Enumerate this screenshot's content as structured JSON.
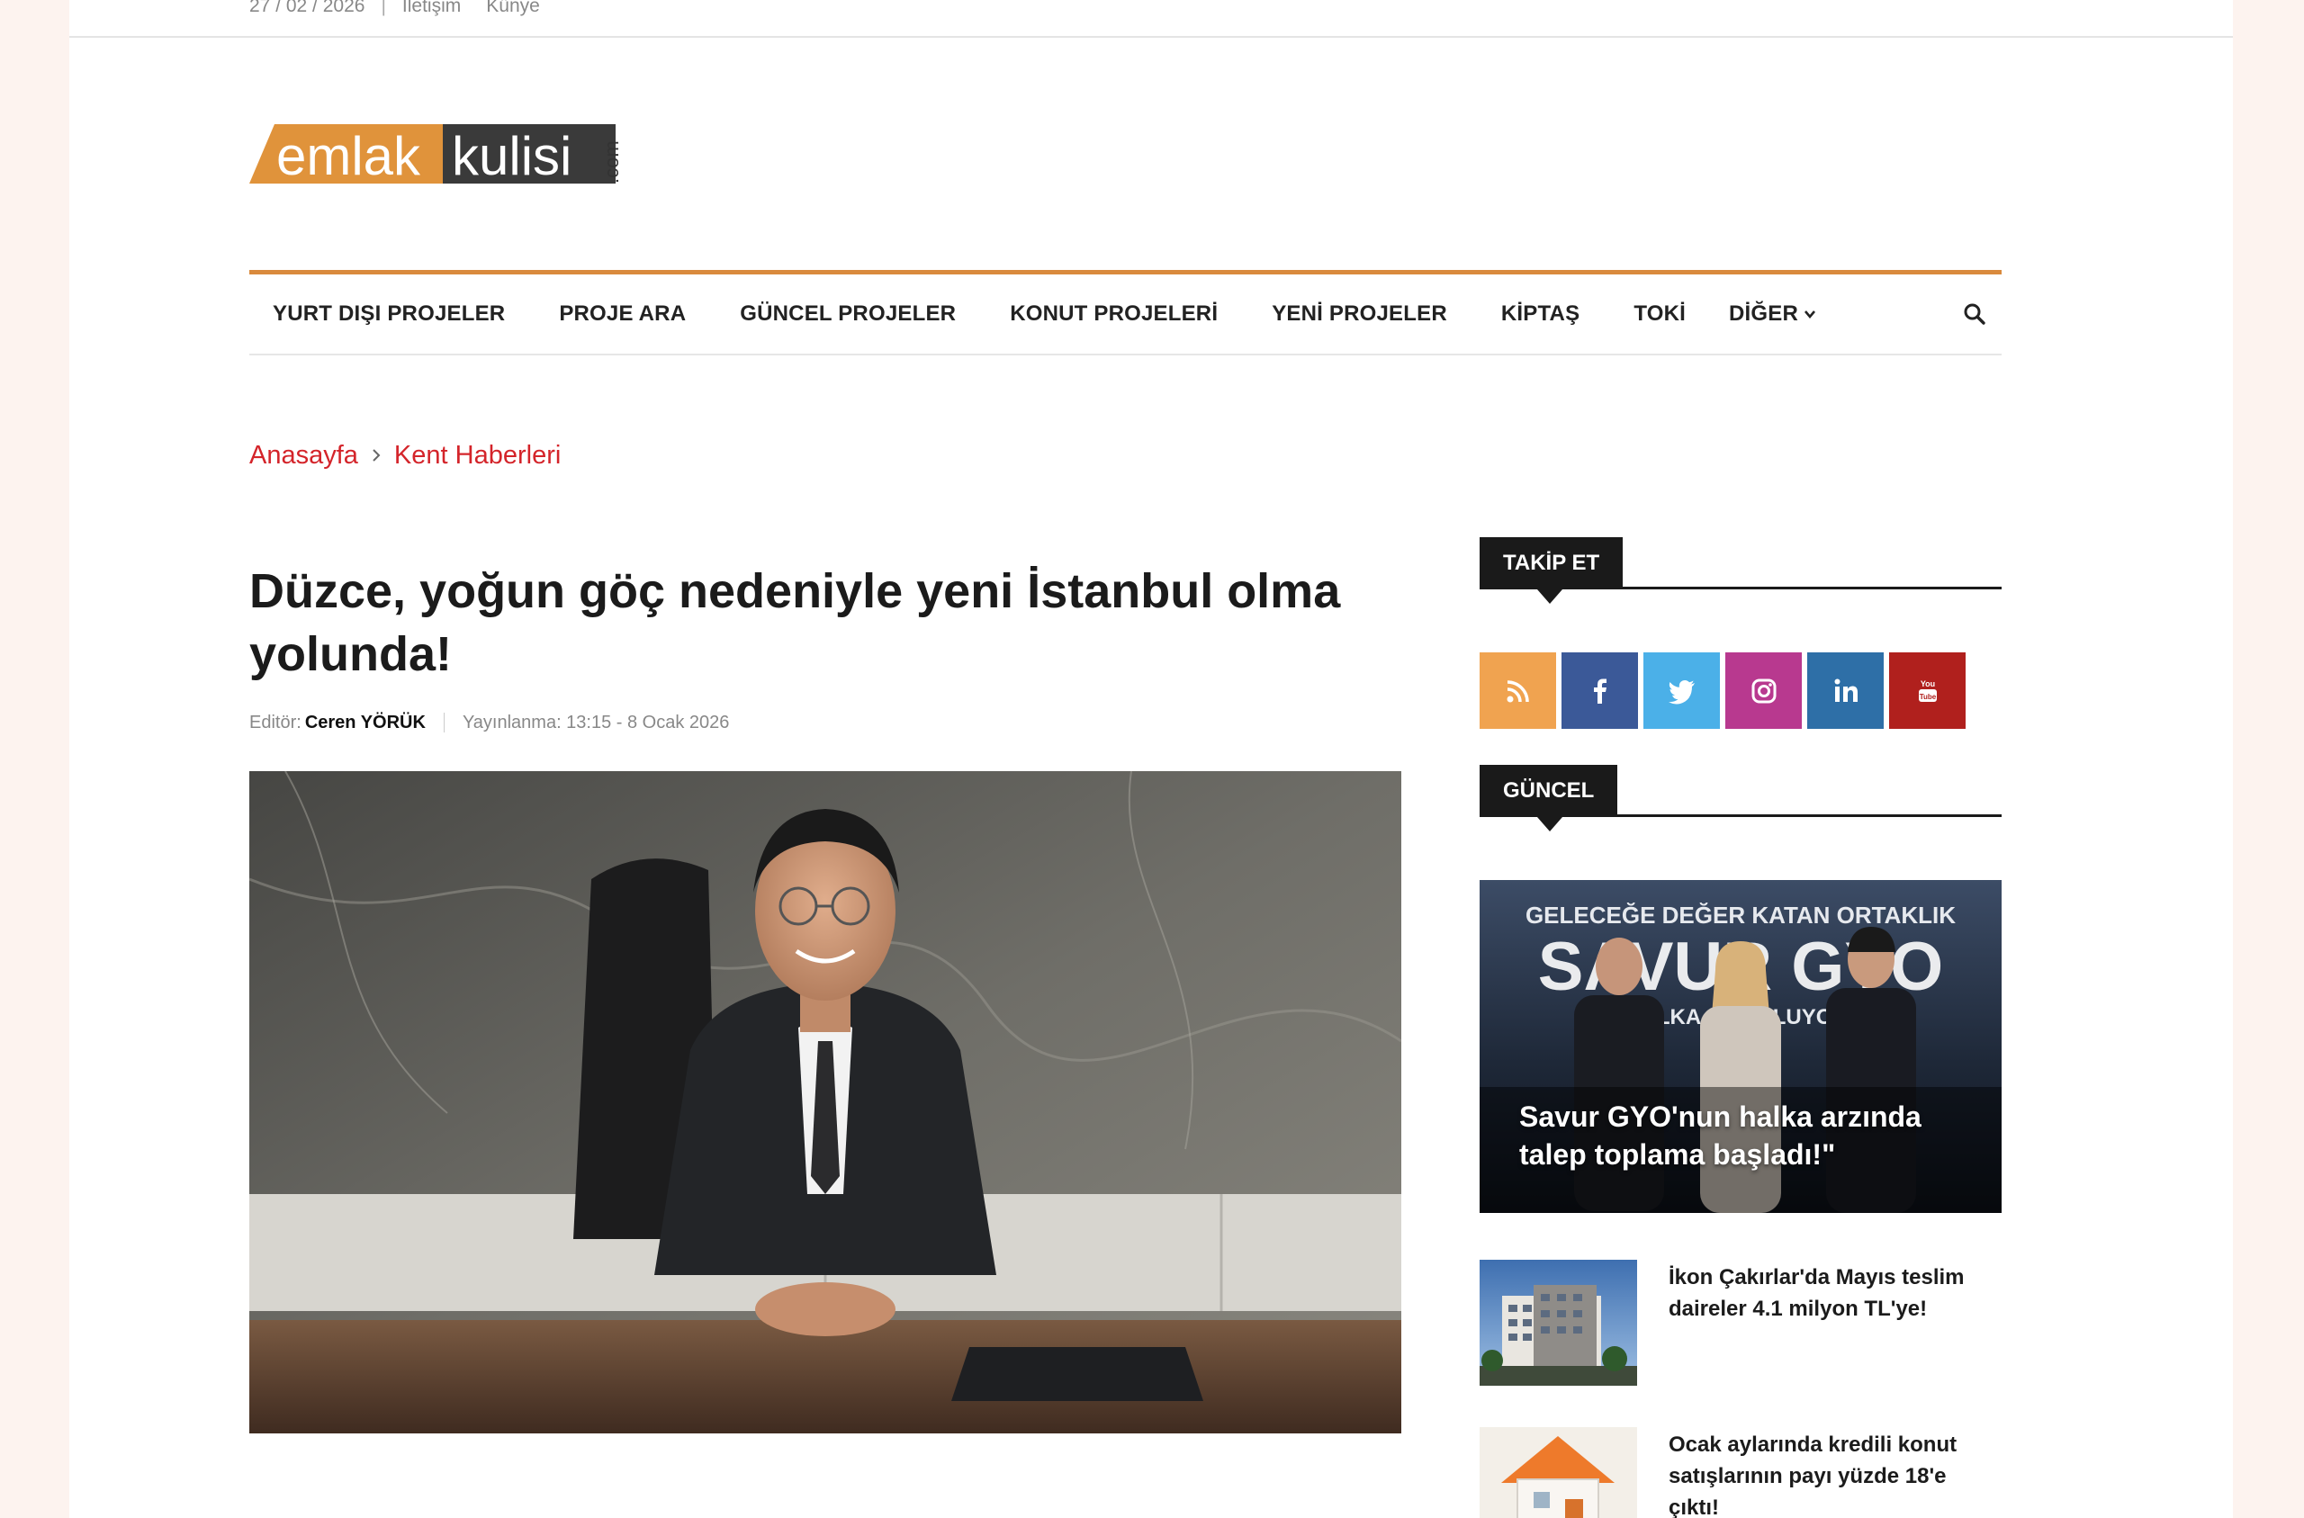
{
  "topbar": {
    "date": "27 / 02 / 2026",
    "links": [
      "İletişim",
      "Künye"
    ]
  },
  "logo": {
    "word1": "emlak",
    "word2": "kulisi",
    "suffix": ".com",
    "colors": {
      "orange": "#e0933b",
      "dark": "#3a3a3a"
    }
  },
  "nav": {
    "items": [
      "YURT DIŞI PROJELER",
      "PROJE ARA",
      "GÜNCEL PROJELER",
      "KONUT PROJELERİ",
      "YENİ PROJELER",
      "KİPTAŞ",
      "TOKİ"
    ],
    "more": "DİĞER",
    "accent": "#d98a3d"
  },
  "breadcrumb": {
    "home": "Anasayfa",
    "category": "Kent Haberleri"
  },
  "article": {
    "title": "Düzce, yoğun göç nedeniyle yeni İstanbul olma yolunda!",
    "editor_label": "Editör:",
    "editor_name": "Ceren YÖRÜK",
    "published": "Yayınlanma: 13:15 - 8 Ocak 2026"
  },
  "sidebar": {
    "follow_title": "TAKİP ET",
    "social": [
      {
        "icon": "rss-icon",
        "color": "#f0a350"
      },
      {
        "icon": "facebook-icon",
        "color": "#3b5998"
      },
      {
        "icon": "twitter-icon",
        "color": "#4bb0e8"
      },
      {
        "icon": "instagram-icon",
        "color": "#b8398f"
      },
      {
        "icon": "linkedin-icon",
        "color": "#2e6fa7"
      },
      {
        "icon": "youtube-icon",
        "color": "#b0201d"
      }
    ],
    "news_title": "GÜNCEL",
    "featured": {
      "caption": "Savur GYO'nun halka arzında talep toplama başladı!\"",
      "banner_top": "GELECEĞE DEĞER KATAN ORTAKLIK",
      "banner_mid": "SAVUR GYO",
      "banner_bottom": "HALKA ARZ OLUYOR!"
    },
    "items": [
      {
        "title": "İkon Çakırlar'da Mayıs teslim daireler 4.1 milyon TL'ye!"
      },
      {
        "title": "Ocak aylarında kredili konut satışlarının payı yüzde 18'e çıktı!"
      }
    ]
  }
}
